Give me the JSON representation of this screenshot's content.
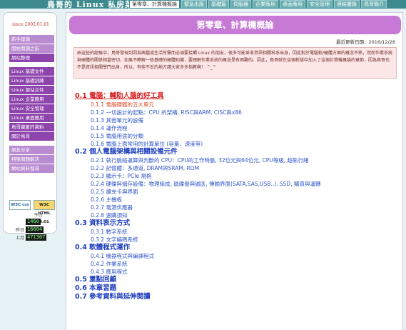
{
  "site": {
    "title": "鳥哥的 Linux 私房菜",
    "tabs": [
      "第零章、計算機概論",
      "緊急出版",
      "基礎篇",
      "伺服器",
      "企業應用",
      "桌面應用",
      "安全管理",
      "連結叢錄",
      "鳥哥簡介"
    ],
    "active_tab": 0
  },
  "sidebar": {
    "since": "since 2002.01.01",
    "items": [
      {
        "label": "新手建議",
        "style": "light"
      },
      {
        "label": "開始閱讀之前",
        "style": "light"
      },
      {
        "label": "網站整理",
        "style": "dark"
      },
      {
        "label": "Linux 基礎文件",
        "style": "dark",
        "gap_before": true
      },
      {
        "label": "Linux 基礎訓練",
        "style": "dark"
      },
      {
        "label": "Linux 架站文件",
        "style": "dark"
      },
      {
        "label": "Linux 企業應用",
        "style": "dark"
      },
      {
        "label": "Linux 安全管理",
        "style": "dark"
      },
      {
        "label": "Linux 桌面應用",
        "style": "dark"
      },
      {
        "label": "鳥哥藏匿的資料",
        "style": "dark"
      },
      {
        "label": "關於鳥哥",
        "style": "dark"
      },
      {
        "label": "網友分享",
        "style": "light",
        "gap_before": true
      },
      {
        "label": "特殊問題解決",
        "style": "light"
      },
      {
        "label": "網站資料搜尋",
        "style": "light"
      }
    ],
    "badges": {
      "css": "W3C css",
      "html": "W3C HTML 4.01"
    },
    "counter": {
      "today_label": "今日",
      "today_value": "1460",
      "yesterday_label": "昨日",
      "yesterday_value": "16604",
      "month_label": "上月",
      "month_value": "471307"
    }
  },
  "main": {
    "chapter_title": "第零章、計算機概論",
    "updated": "最近更新日期：2016/12/28",
    "intro": "由這些的經驗中，鳥哥發現到因為興趣或生活所需而必須要接觸 Linux 的朋友，很多可能並非資訊相關科系出身，因此對於電腦軟/硬體方面的概念不熟，然而作業系統與硬體的關係相當密切，如果不瞭解一些基礎的硬體知識，要理解作業系統的概念是有困難的。因此，鳥哥就在這個新版中加入了這個計算機概論的章節，因為鳥哥也不是資訊相關學門出身，所以，有些不妥的地方請大家多多指教啊！ ^_^",
    "toc": [
      {
        "level": 1,
        "text": "0.1 電腦：輔助人腦的好工具",
        "current": true
      },
      {
        "level": 2,
        "text": "0.1.1 電腦硬體的五大單元",
        "current": true
      },
      {
        "level": 2,
        "text": "0.1.2 一切設計的起點：CPU 的架構, RISC與ARM, CISC與x86"
      },
      {
        "level": 2,
        "text": "0.1.3 其他單元的設備"
      },
      {
        "level": 2,
        "text": "0.1.4 運作流程"
      },
      {
        "level": 2,
        "text": "0.1.5 電腦用途的分類"
      },
      {
        "level": 2,
        "text": "0.1.6 電腦上面常用的計算單位 (容量、速度等)"
      },
      {
        "level": 1,
        "text": "0.2 個人電腦架構與相關設備元件"
      },
      {
        "level": 2,
        "text": "0.2.1 執行脈絡運算與判斷的 CPU：CPU的工作時脈, 32位元與64位元, CPU等級, 超執行緒"
      },
      {
        "level": 2,
        "text": "0.2.2 記憶體：多通道, DRAM與SRAM, ROM"
      },
      {
        "level": 2,
        "text": "0.2.3 顯示卡：PCIe 規格"
      },
      {
        "level": 2,
        "text": "0.2.4 硬碟與儲存設備：物理組成, 磁碟盤與磁區, 傳輸界面(SATA,SAS,USB..), SSD, 購買與運轉"
      },
      {
        "level": 2,
        "text": "0.2.5 擴充卡與界面"
      },
      {
        "level": 2,
        "text": "0.2.6 主機板"
      },
      {
        "level": 2,
        "text": "0.2.7 電源供應器"
      },
      {
        "level": 2,
        "text": "0.2.8 選購須知"
      },
      {
        "level": 1,
        "text": "0.3 資料表示方式"
      },
      {
        "level": 2,
        "text": "0.3.1 數字系統"
      },
      {
        "level": 2,
        "text": "0.3.2 文字編碼系統"
      },
      {
        "level": 1,
        "text": "0.4 軟體程式運作"
      },
      {
        "level": 2,
        "text": "0.4.1 機器程式與編譯程式"
      },
      {
        "level": 2,
        "text": "0.4.2 作業系統"
      },
      {
        "level": 2,
        "text": "0.4.3 應用程式"
      },
      {
        "level": 1,
        "text": "0.5 重點回顧"
      },
      {
        "level": 1,
        "text": "0.6 本章習題"
      },
      {
        "level": 1,
        "text": "0.7 參考資料與延伸閱讀"
      }
    ]
  }
}
